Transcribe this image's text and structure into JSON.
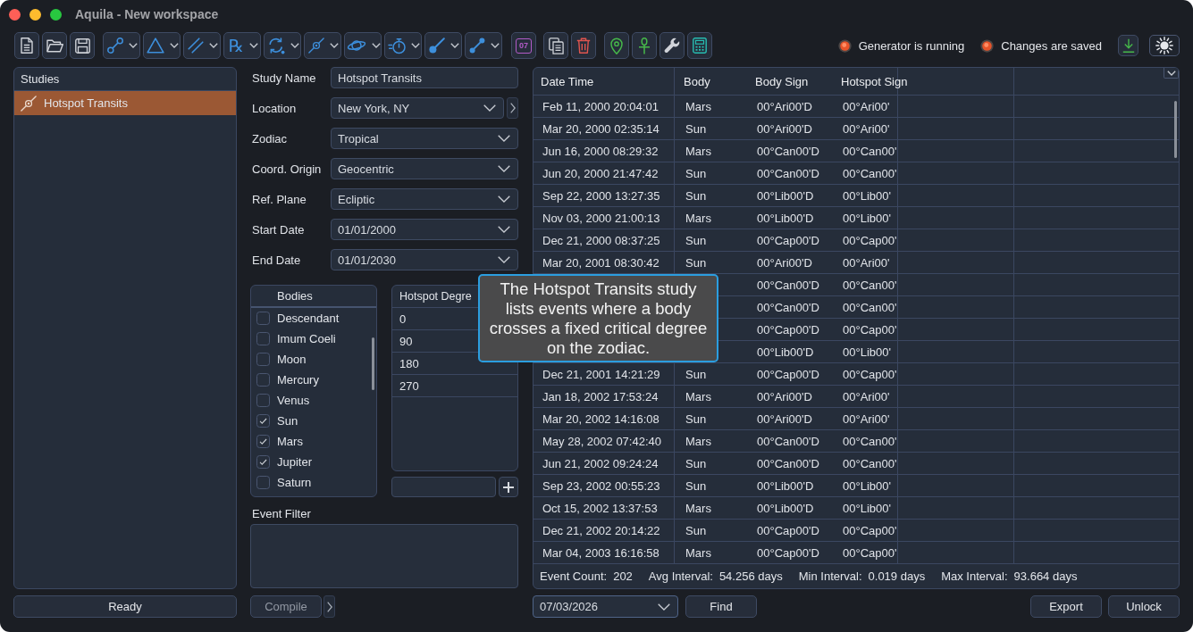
{
  "window": {
    "title": "Aquila - New workspace"
  },
  "toolbar": {
    "symbol_button": {
      "label": "℞"
    },
    "calendar_button": {
      "label": "07"
    }
  },
  "status_indicators": [
    {
      "label": "Generator is running"
    },
    {
      "label": "Changes are saved"
    }
  ],
  "studies": {
    "title": "Studies",
    "items": [
      {
        "label": "Hotspot Transits",
        "selected": true
      }
    ]
  },
  "status_button": {
    "label": "Ready"
  },
  "form": {
    "fields": [
      {
        "label": "Study Name",
        "kind": "text",
        "value": "Hotspot Transits"
      },
      {
        "label": "Location",
        "kind": "picker",
        "value": "New York, NY"
      },
      {
        "label": "Zodiac",
        "kind": "select",
        "value": "Tropical"
      },
      {
        "label": "Coord. Origin",
        "kind": "select",
        "value": "Geocentric"
      },
      {
        "label": "Ref. Plane",
        "kind": "select",
        "value": "Ecliptic"
      },
      {
        "label": "Start Date",
        "kind": "select",
        "value": "01/01/2000"
      },
      {
        "label": "End Date",
        "kind": "select",
        "value": "01/01/2030"
      }
    ]
  },
  "bodies": {
    "title": "Bodies",
    "items": [
      {
        "label": "Descendant",
        "checked": false
      },
      {
        "label": "Imum Coeli",
        "checked": false
      },
      {
        "label": "Moon",
        "checked": false
      },
      {
        "label": "Mercury",
        "checked": false
      },
      {
        "label": "Venus",
        "checked": false
      },
      {
        "label": "Sun",
        "checked": true
      },
      {
        "label": "Mars",
        "checked": true
      },
      {
        "label": "Jupiter",
        "checked": true
      },
      {
        "label": "Saturn",
        "checked": false
      }
    ]
  },
  "hotspot_degrees": {
    "title": "Hotspot Degre",
    "values": [
      "0",
      "90",
      "180",
      "270"
    ]
  },
  "event_filter": {
    "label": "Event Filter"
  },
  "compile_button": {
    "label": "Compile",
    "disabled": true
  },
  "table": {
    "columns": [
      "Date Time",
      "Body",
      "Body Sign",
      "Hotspot Sign"
    ],
    "rows": [
      {
        "date_time": "Feb 11, 2000 20:04:01",
        "body": "Mars",
        "body_sign": "00°Ari00'D",
        "hotspot_sign": "00°Ari00'"
      },
      {
        "date_time": "Mar 20, 2000 02:35:14",
        "body": "Sun",
        "body_sign": "00°Ari00'D",
        "hotspot_sign": "00°Ari00'"
      },
      {
        "date_time": "Jun 16, 2000 08:29:32",
        "body": "Mars",
        "body_sign": "00°Can00'D",
        "hotspot_sign": "00°Can00'"
      },
      {
        "date_time": "Jun 20, 2000 21:47:42",
        "body": "Sun",
        "body_sign": "00°Can00'D",
        "hotspot_sign": "00°Can00'"
      },
      {
        "date_time": "Sep 22, 2000 13:27:35",
        "body": "Sun",
        "body_sign": "00°Lib00'D",
        "hotspot_sign": "00°Lib00'"
      },
      {
        "date_time": "Nov 03, 2000 21:00:13",
        "body": "Mars",
        "body_sign": "00°Lib00'D",
        "hotspot_sign": "00°Lib00'"
      },
      {
        "date_time": "Dec 21, 2000 08:37:25",
        "body": "Sun",
        "body_sign": "00°Cap00'D",
        "hotspot_sign": "00°Cap00'"
      },
      {
        "date_time": "Mar 20, 2001 08:30:42",
        "body": "Sun",
        "body_sign": "00°Ari00'D",
        "hotspot_sign": "00°Ari00'"
      },
      {
        "body_sign": "00°Can00'D",
        "hotspot_sign": "00°Can00'"
      },
      {
        "body_sign": "00°Can00'D",
        "hotspot_sign": "00°Can00'"
      },
      {
        "body_sign": "00°Cap00'D",
        "hotspot_sign": "00°Cap00'"
      },
      {
        "body_sign": "00°Lib00'D",
        "hotspot_sign": "00°Lib00'"
      },
      {
        "date_time": "Dec 21, 2001 14:21:29",
        "body": "Sun",
        "body_sign": "00°Cap00'D",
        "hotspot_sign": "00°Cap00'"
      },
      {
        "date_time": "Jan 18, 2002 17:53:24",
        "body": "Mars",
        "body_sign": "00°Ari00'D",
        "hotspot_sign": "00°Ari00'"
      },
      {
        "date_time": "Mar 20, 2002 14:16:08",
        "body": "Sun",
        "body_sign": "00°Ari00'D",
        "hotspot_sign": "00°Ari00'"
      },
      {
        "date_time": "May 28, 2002 07:42:40",
        "body": "Mars",
        "body_sign": "00°Can00'D",
        "hotspot_sign": "00°Can00'"
      },
      {
        "date_time": "Jun 21, 2002 09:24:24",
        "body": "Sun",
        "body_sign": "00°Can00'D",
        "hotspot_sign": "00°Can00'"
      },
      {
        "date_time": "Sep 23, 2002 00:55:23",
        "body": "Sun",
        "body_sign": "00°Lib00'D",
        "hotspot_sign": "00°Lib00'"
      },
      {
        "date_time": "Oct 15, 2002 13:37:53",
        "body": "Mars",
        "body_sign": "00°Lib00'D",
        "hotspot_sign": "00°Lib00'"
      },
      {
        "date_time": "Dec 21, 2002 20:14:22",
        "body": "Sun",
        "body_sign": "00°Cap00'D",
        "hotspot_sign": "00°Cap00'"
      },
      {
        "date_time": "Mar 04, 2003 16:16:58",
        "body": "Mars",
        "body_sign": "00°Cap00'D",
        "hotspot_sign": "00°Cap00'"
      }
    ]
  },
  "summary": [
    {
      "label": "Event Count:",
      "value": "202"
    },
    {
      "label": "Avg Interval:",
      "value": "54.256 days"
    },
    {
      "label": "Min Interval:",
      "value": "0.019 days"
    },
    {
      "label": "Max Interval:",
      "value": "93.664 days"
    }
  ],
  "date_picker": {
    "value": "07/03/2026"
  },
  "find_button": {
    "label": "Find"
  },
  "actions": [
    {
      "label": "Export"
    },
    {
      "label": "Unlock"
    }
  ],
  "tooltip": {
    "text": "The Hotspot Transits study lists events where a body crosses a fixed critical degree on the zodiac."
  }
}
